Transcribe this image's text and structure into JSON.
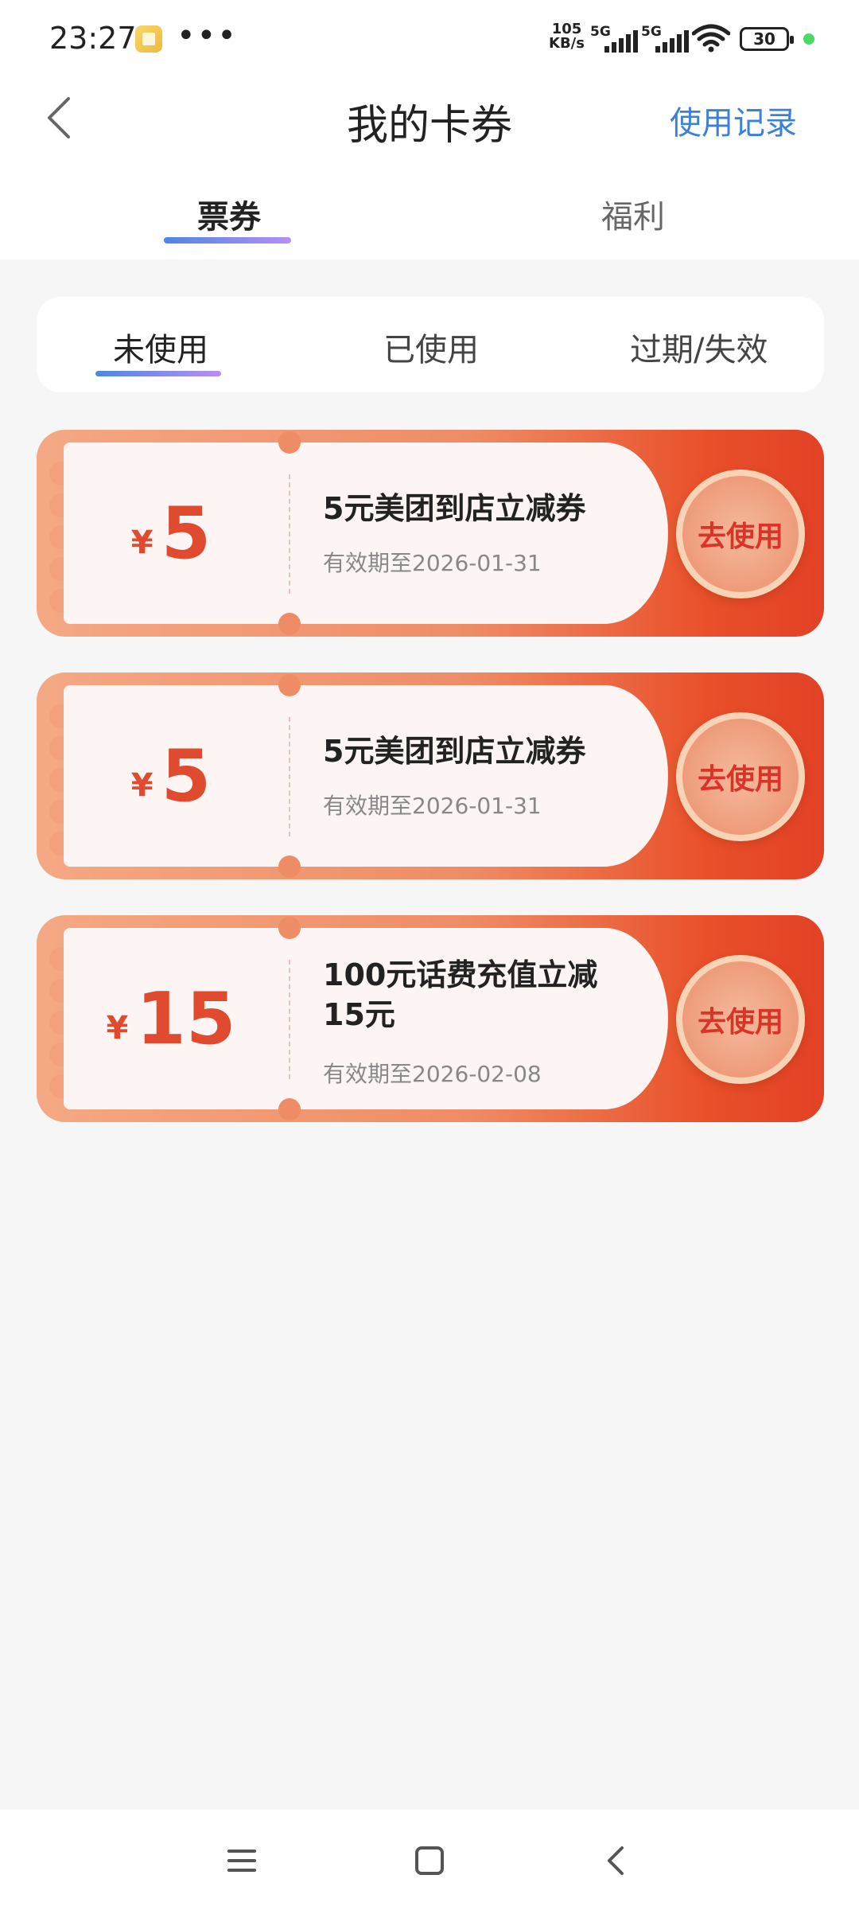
{
  "status_bar": {
    "time": "23:27",
    "net_speed_value": "105",
    "net_speed_unit": "KB/s",
    "signal1": "5G",
    "signal2": "5G",
    "battery": "30"
  },
  "header": {
    "title": "我的卡券",
    "record_link": "使用记录"
  },
  "main_tabs": [
    {
      "label": "票券",
      "active": true
    },
    {
      "label": "福利",
      "active": false
    }
  ],
  "sub_tabs": [
    {
      "label": "未使用",
      "active": true
    },
    {
      "label": "已使用",
      "active": false
    },
    {
      "label": "过期/失效",
      "active": false
    }
  ],
  "coupons": [
    {
      "currency": "¥",
      "amount": "5",
      "name": "5元美团到店立减券",
      "expiry": "有效期至2026-01-31",
      "button": "去使用"
    },
    {
      "currency": "¥",
      "amount": "5",
      "name": "5元美团到店立减券",
      "expiry": "有效期至2026-01-31",
      "button": "去使用"
    },
    {
      "currency": "¥",
      "amount": "15",
      "name": "100元话费充值立减15元",
      "expiry": "有效期至2026-02-08",
      "button": "去使用"
    }
  ],
  "colors": {
    "accent_blue": "#3a82d8",
    "amount_red": "#e04a2f",
    "coupon_orange": "#ee8c66"
  },
  "icons": [
    "back-arrow-icon",
    "menu-icon",
    "home-icon",
    "back-icon"
  ]
}
